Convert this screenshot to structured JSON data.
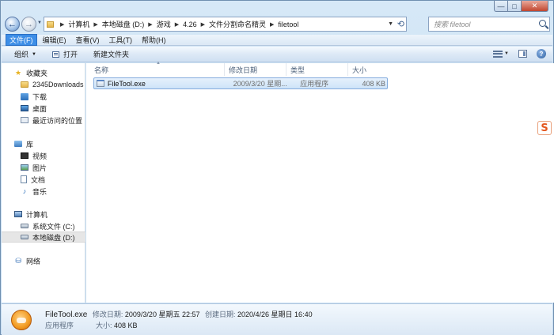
{
  "address": {
    "crumbs": [
      "计算机",
      "本地磁盘 (D:)",
      "游戏",
      "4.26",
      "文件分割命名精灵",
      "filetool"
    ],
    "search_placeholder": "搜索 filetool"
  },
  "menu": [
    "文件(F)",
    "编辑(E)",
    "查看(V)",
    "工具(T)",
    "帮助(H)"
  ],
  "toolbar": {
    "organize": "组织",
    "open": "打开",
    "new_folder": "新建文件夹"
  },
  "nav": {
    "favorites": "收藏夹",
    "favorites_items": [
      "2345Downloads",
      "下载",
      "桌面",
      "最近访问的位置"
    ],
    "libraries": "库",
    "libraries_items": [
      "视频",
      "图片",
      "文档",
      "音乐"
    ],
    "computer": "计算机",
    "computer_items": [
      "系统文件 (C:)",
      "本地磁盘 (D:)"
    ],
    "network": "网络"
  },
  "columns": {
    "name": "名称",
    "date": "修改日期",
    "type": "类型",
    "size": "大小"
  },
  "files": [
    {
      "name": "FileTool.exe",
      "date": "2009/3/20 星期...",
      "type": "应用程序",
      "size": "408 KB"
    }
  ],
  "details": {
    "filename": "FileTool.exe",
    "modified_label": "修改日期:",
    "modified_value": "2009/3/20 星期五 22:57",
    "created_label": "创建日期:",
    "created_value": "2020/4/26 星期日 16:40",
    "type": "应用程序",
    "size_label": "大小:",
    "size_value": "408 KB"
  },
  "tray_badge": "S"
}
